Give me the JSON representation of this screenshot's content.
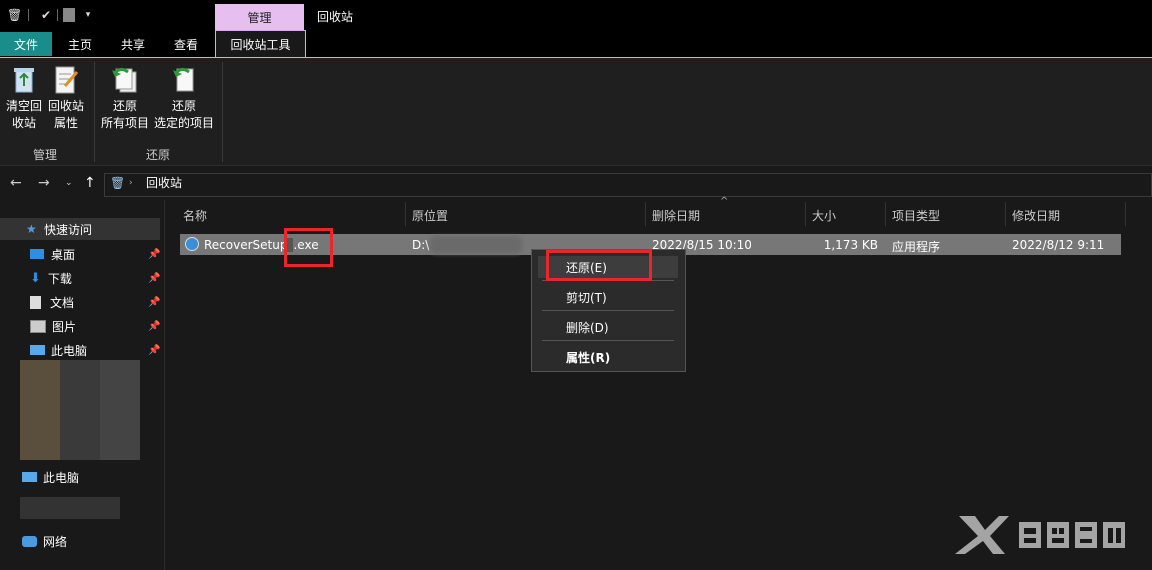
{
  "window": {
    "title": "回收站",
    "context_tab": "管理"
  },
  "tabs": {
    "file": "文件",
    "home": "主页",
    "share": "共享",
    "view": "查看",
    "recycle_tools": "回收站工具"
  },
  "ribbon": {
    "empty_bin": [
      "清空回",
      "收站"
    ],
    "bin_properties": [
      "回收站",
      "属性"
    ],
    "restore_all": [
      "还原",
      "所有项目"
    ],
    "restore_selected": [
      "还原",
      "选定的项目"
    ],
    "group_manage": "管理",
    "group_restore": "还原"
  },
  "address": {
    "path": "回收站"
  },
  "nav": {
    "quick_access": "快速访问",
    "items": [
      "桌面",
      "下载",
      "文档",
      "图片",
      "此电脑"
    ],
    "this_pc": "此电脑",
    "network": "网络"
  },
  "columns": {
    "name": "名称",
    "original": "原位置",
    "deleted": "删除日期",
    "size": "大小",
    "type": "项目类型",
    "modified": "修改日期"
  },
  "file": {
    "name_prefix": "RecoverSetup",
    "name_ext": ".exe",
    "original": "D:\\",
    "deleted": "2022/8/15 10:10",
    "size": "1,173 KB",
    "type": "应用程序",
    "modified": "2022/8/12 9:11"
  },
  "context_menu": {
    "restore": "还原(E)",
    "cut": "剪切(T)",
    "delete": "删除(D)",
    "properties": "属性(R)"
  },
  "colors": {
    "accent_file_tab": "#1a8c8a",
    "context_tab": "#e6bff0",
    "highlight_box": "#e8262b"
  }
}
